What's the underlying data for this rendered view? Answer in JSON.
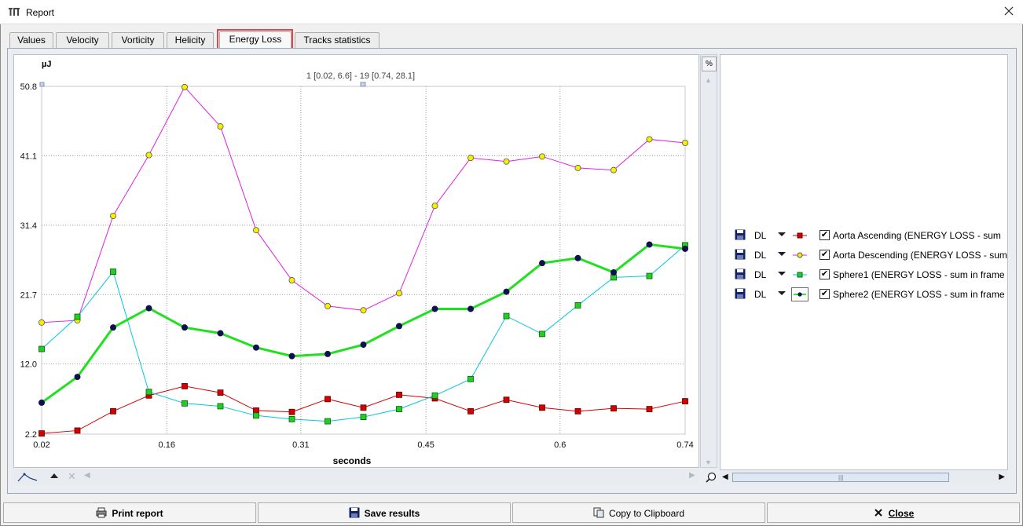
{
  "window": {
    "title": "Report"
  },
  "tabs": [
    {
      "label": "Values"
    },
    {
      "label": "Velocity"
    },
    {
      "label": "Vorticity"
    },
    {
      "label": "Helicity"
    },
    {
      "label": "Energy Loss"
    },
    {
      "label": "Tracks statistics"
    }
  ],
  "active_tab": "Energy Loss",
  "percent_button": "%",
  "legend": [
    {
      "dl": "DL",
      "name": "Aorta Ascending (ENERGY LOSS  - sum",
      "color": "#d40000",
      "marker": "square"
    },
    {
      "dl": "DL",
      "name": "Aorta Descending (ENERGY LOSS  - sum",
      "color": "#e020e0",
      "marker": "circle-yellow"
    },
    {
      "dl": "DL",
      "name": "Sphere1 (ENERGY LOSS  - sum in frame",
      "color": "#00c8dc",
      "marker": "square-green"
    },
    {
      "dl": "DL",
      "name": "Sphere2 (ENERGY LOSS  - sum in frame",
      "color": "#20e020",
      "marker": "circle-navy"
    }
  ],
  "buttons": {
    "print": "Print report",
    "save": "Save results",
    "copy": "Copy to Clipboard",
    "close": "Close"
  },
  "chart_data": {
    "type": "line",
    "ylabel": "µJ",
    "xlabel": "seconds",
    "annotation": "1 [0.02, 6.6] - 19 [0.74, 28.1]",
    "ylim": [
      2.2,
      50.8
    ],
    "xlim": [
      0.02,
      0.74
    ],
    "y_ticks": [
      "50.8",
      "41.1",
      "31.4",
      "21.7",
      "12.0",
      "2.2"
    ],
    "x_ticks": [
      "0.02",
      "0.16",
      "0.31",
      "0.45",
      "0.6",
      "0.74"
    ],
    "grid": true,
    "x": [
      0.02,
      0.06,
      0.1,
      0.14,
      0.18,
      0.22,
      0.26,
      0.3,
      0.34,
      0.38,
      0.42,
      0.46,
      0.5,
      0.54,
      0.58,
      0.62,
      0.66,
      0.7,
      0.74
    ],
    "series": [
      {
        "name": "Aorta Ascending",
        "color": "#d40000",
        "marker": "square",
        "marker_fill": "#d40000",
        "stroke_width": 1,
        "values": [
          2.3,
          2.7,
          5.4,
          7.6,
          8.9,
          8.0,
          5.5,
          5.3,
          7.1,
          5.9,
          7.7,
          7.2,
          5.4,
          7.0,
          5.9,
          5.4,
          5.8,
          5.7,
          6.8
        ]
      },
      {
        "name": "Aorta Descending",
        "color": "#e020e0",
        "marker": "circle",
        "marker_fill": "#f4f000",
        "stroke_width": 1,
        "values": [
          17.8,
          18.1,
          32.7,
          41.2,
          50.7,
          45.2,
          30.7,
          23.7,
          20.1,
          19.5,
          21.9,
          34.1,
          40.8,
          40.3,
          41.0,
          39.4,
          39.1,
          43.4,
          42.9
        ]
      },
      {
        "name": "Sphere1",
        "color": "#00c8dc",
        "marker": "square",
        "marker_fill": "#20d020",
        "stroke_width": 1,
        "values": [
          14.1,
          18.6,
          24.9,
          8.1,
          6.5,
          6.1,
          4.8,
          4.3,
          4.0,
          4.6,
          5.7,
          7.6,
          9.9,
          18.7,
          16.2,
          20.2,
          24.1,
          24.3,
          28.6
        ]
      },
      {
        "name": "Sphere2",
        "color": "#20e020",
        "marker": "circle",
        "marker_fill": "#101050",
        "stroke_width": 3,
        "values": [
          6.6,
          10.2,
          17.1,
          19.8,
          17.1,
          16.3,
          14.3,
          13.1,
          13.4,
          14.7,
          17.3,
          19.7,
          19.7,
          22.1,
          26.1,
          26.8,
          24.8,
          28.7,
          28.1
        ]
      }
    ]
  }
}
